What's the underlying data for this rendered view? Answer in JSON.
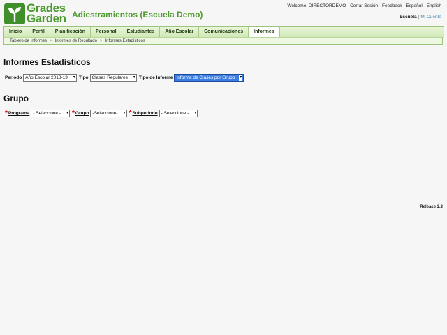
{
  "app": {
    "logo_line1": "Grades",
    "logo_line2": "Garden",
    "school_title": "Adiestramientos (Escuela Demo)"
  },
  "top_links": {
    "welcome": "Welcome: DIRECTORDEMO",
    "logout": "Cerrar Sesión",
    "feedback": "Feedback",
    "spanish": "Español",
    "english": "English"
  },
  "account_links": {
    "school": "Escuela",
    "separator": "|",
    "my_account": "Mi Cuenta"
  },
  "nav": [
    {
      "label": "Inicio"
    },
    {
      "label": "Perfil"
    },
    {
      "label": "Planificación"
    },
    {
      "label": "Personal"
    },
    {
      "label": "Estudiantes"
    },
    {
      "label": "Año Escolar"
    },
    {
      "label": "Comunicaciones"
    },
    {
      "label": "Informes"
    }
  ],
  "breadcrumb": [
    "Tablero de Informes",
    "Informes de Resultado",
    "Informes Estadísticos"
  ],
  "page_title": "Informes Estadísticos",
  "filters": {
    "period_label": "Periodo",
    "period_value": "Año Escolar 2018-19",
    "type_label": "Tipo",
    "type_value": "Clases Regulares",
    "report_type_label": "Tipo de Informe",
    "report_type_value": "Informe de Clases por Grupo"
  },
  "section_title": "Grupo",
  "group_filters": {
    "required_mark": "*",
    "program_label": "Programa",
    "program_value": "- Seleccione -",
    "group_label": "Grupo",
    "group_value": "-Seleccione-",
    "subperiod_label": "Subperiodo",
    "subperiod_value": "- Seleccione -"
  },
  "footer": {
    "release": "Release 3.3"
  },
  "colors": {
    "brand_green": "#4a9a2e",
    "nav_border": "#9cc47d",
    "highlight_blue": "#3b7ee3",
    "required_red": "#d20000"
  }
}
